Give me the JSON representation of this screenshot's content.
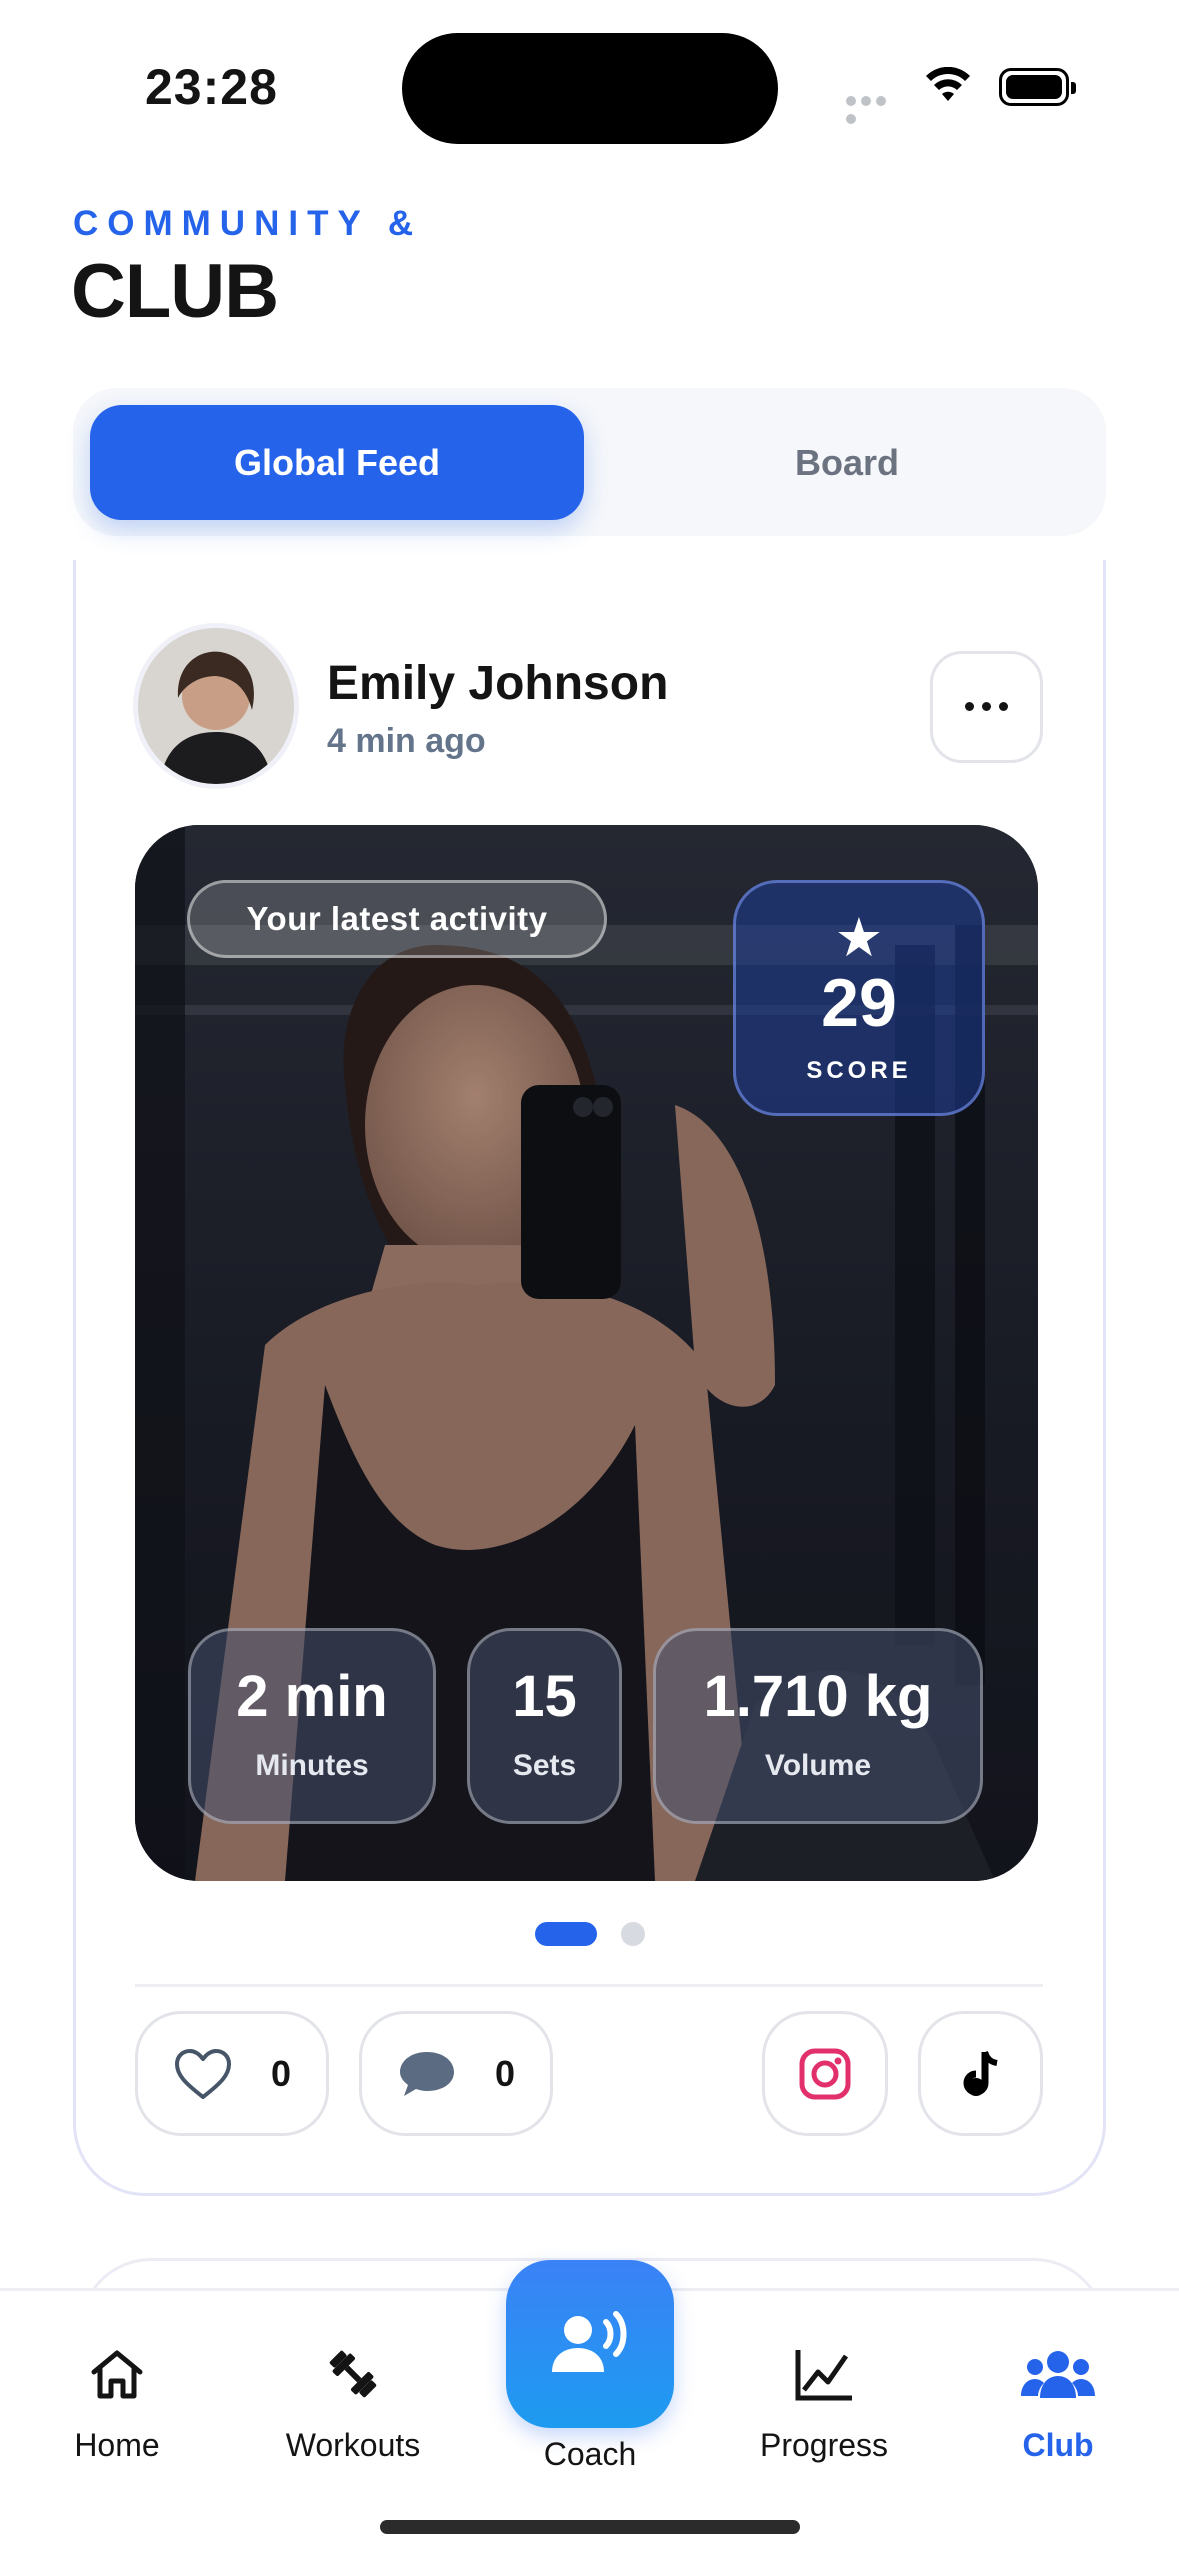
{
  "status_bar": {
    "time": "23:28"
  },
  "header": {
    "kicker": "COMMUNITY &",
    "title": "CLUB"
  },
  "segment": {
    "tabs": [
      "Global Feed",
      "Board"
    ],
    "active": "Global Feed"
  },
  "post": {
    "user_name": "Emily Johnson",
    "time_ago": "4 min ago",
    "activity_label": "Your latest activity",
    "score": {
      "value": "29",
      "label": "SCORE",
      "icon": "star-icon"
    },
    "stats": [
      {
        "value": "2 min",
        "label": "Minutes"
      },
      {
        "value": "15",
        "label": "Sets"
      },
      {
        "value": "1.710 kg",
        "label": "Volume"
      }
    ],
    "carousel": {
      "pages": 2,
      "current": 1
    },
    "likes": "0",
    "comments": "0"
  },
  "tab_bar": {
    "items": [
      {
        "label": "Home",
        "icon": "home-icon"
      },
      {
        "label": "Workouts",
        "icon": "dumbbell-icon"
      },
      {
        "label": "Coach",
        "icon": "coach-voice-icon"
      },
      {
        "label": "Progress",
        "icon": "chart-icon"
      },
      {
        "label": "Club",
        "icon": "people-icon"
      }
    ],
    "active": "Club"
  },
  "colors": {
    "accent": "#2563eb",
    "muted": "#64748b",
    "instagram": "#e1306c"
  }
}
